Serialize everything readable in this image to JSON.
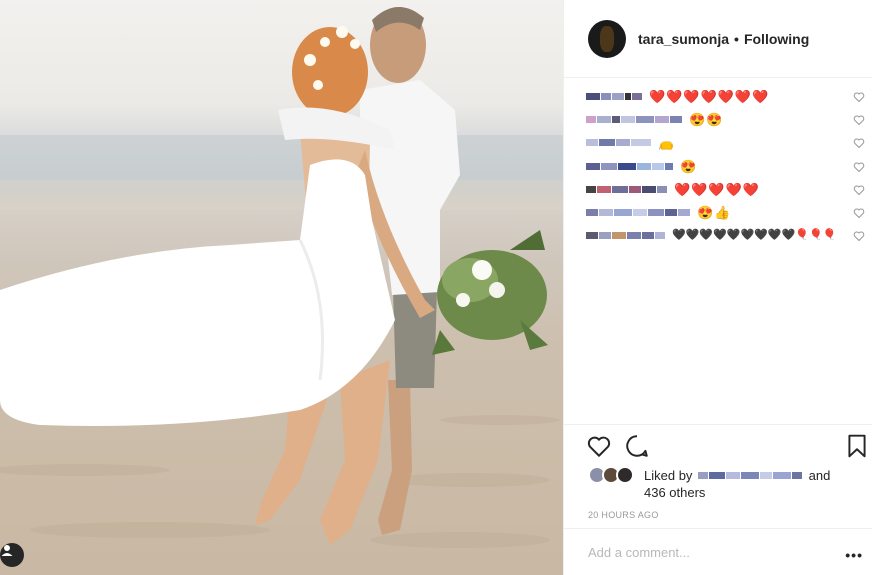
{
  "post": {
    "author": "tara_sumonja",
    "separator": "•",
    "follow_status": "Following"
  },
  "comments": [
    {
      "emojis": "❤️❤️❤️❤️❤️❤️❤️"
    },
    {
      "emojis": "😍😍"
    },
    {
      "emojis": "👝"
    },
    {
      "emojis": "😍"
    },
    {
      "emojis": "❤️❤️❤️❤️❤️"
    },
    {
      "emojis": "😍👍"
    },
    {
      "emojis": "🖤🖤🖤🖤🖤🖤🖤🖤🖤🎈🎈🎈"
    }
  ],
  "likes": {
    "prefix": "Liked by",
    "joiner": "and",
    "others": "436 others"
  },
  "timestamp": "20 HOURS AGO",
  "comment_box": {
    "placeholder": "Add a comment..."
  },
  "more_options": "•••",
  "icons": {
    "like": "heart-icon",
    "comment": "comment-icon",
    "save": "bookmark-icon",
    "comment_like": "small-heart-icon",
    "owner": "user-icon"
  },
  "colors": {
    "text": "#262626",
    "border": "#efefef",
    "muted": "#999999",
    "placeholder": "#b8b8b8"
  }
}
